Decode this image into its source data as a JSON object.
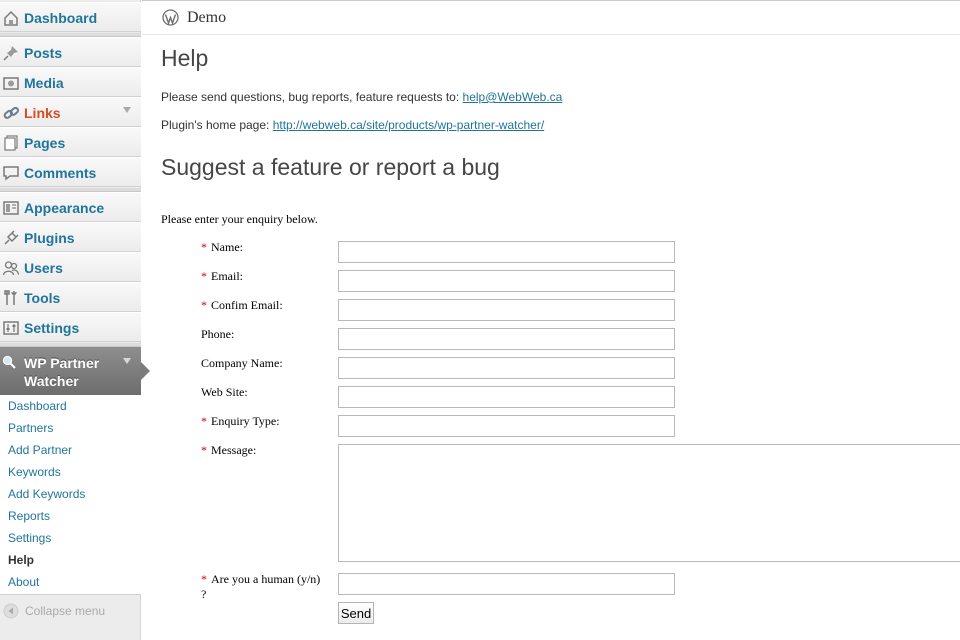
{
  "sidebar": {
    "items": [
      {
        "label": "Dashboard",
        "icon": "dashboard-icon"
      },
      {
        "label": "Posts",
        "icon": "pin-icon"
      },
      {
        "label": "Media",
        "icon": "media-icon"
      },
      {
        "label": "Links",
        "icon": "link-icon"
      },
      {
        "label": "Pages",
        "icon": "pages-icon"
      },
      {
        "label": "Comments",
        "icon": "comment-icon"
      },
      {
        "label": "Appearance",
        "icon": "appearance-icon"
      },
      {
        "label": "Plugins",
        "icon": "plugin-icon"
      },
      {
        "label": "Users",
        "icon": "users-icon"
      },
      {
        "label": "Tools",
        "icon": "tools-icon"
      },
      {
        "label": "Settings",
        "icon": "settings-icon"
      }
    ],
    "plugin_menu": {
      "label": "WP Partner Watcher",
      "icon": "magnifier-icon"
    },
    "submenu": [
      {
        "label": "Dashboard"
      },
      {
        "label": "Partners"
      },
      {
        "label": "Add Partner"
      },
      {
        "label": "Keywords"
      },
      {
        "label": "Add Keywords"
      },
      {
        "label": "Reports"
      },
      {
        "label": "Settings"
      },
      {
        "label": "Help",
        "current": true
      },
      {
        "label": "About"
      }
    ],
    "collapse_label": "Collapse menu"
  },
  "header": {
    "site_name": "Demo",
    "logo_icon": "wordpress-logo-icon"
  },
  "main": {
    "title": "Help",
    "contact_text": "Please send questions, bug reports, feature requests to: ",
    "contact_email": "help@WebWeb.ca",
    "homepage_text": "Plugin's home page: ",
    "homepage_url": "http://webweb.ca/site/products/wp-partner-watcher/",
    "section_title": "Suggest a feature or report a bug"
  },
  "form": {
    "intro": "Please enter your enquiry below.",
    "required_marker": "*",
    "fields": {
      "name": {
        "label": "Name:",
        "value": ""
      },
      "email": {
        "label": "Email:",
        "value": ""
      },
      "confirm_email": {
        "label": "Confim Email:",
        "value": ""
      },
      "phone": {
        "label": "Phone:",
        "value": ""
      },
      "company": {
        "label": "Company Name:",
        "value": ""
      },
      "website": {
        "label": "Web Site:",
        "value": ""
      },
      "enquiry_type": {
        "label": "Enquiry Type:",
        "value": ""
      },
      "message": {
        "label": "Message:",
        "value": ""
      },
      "human": {
        "label": "Are you a human (y/n) ?",
        "value": ""
      }
    },
    "send_label": "Send"
  },
  "colors": {
    "link": "#21759b",
    "links_menu_accent": "#d54e21",
    "required": "#cc0000",
    "active_menu_bg": "#7c7c7c"
  }
}
